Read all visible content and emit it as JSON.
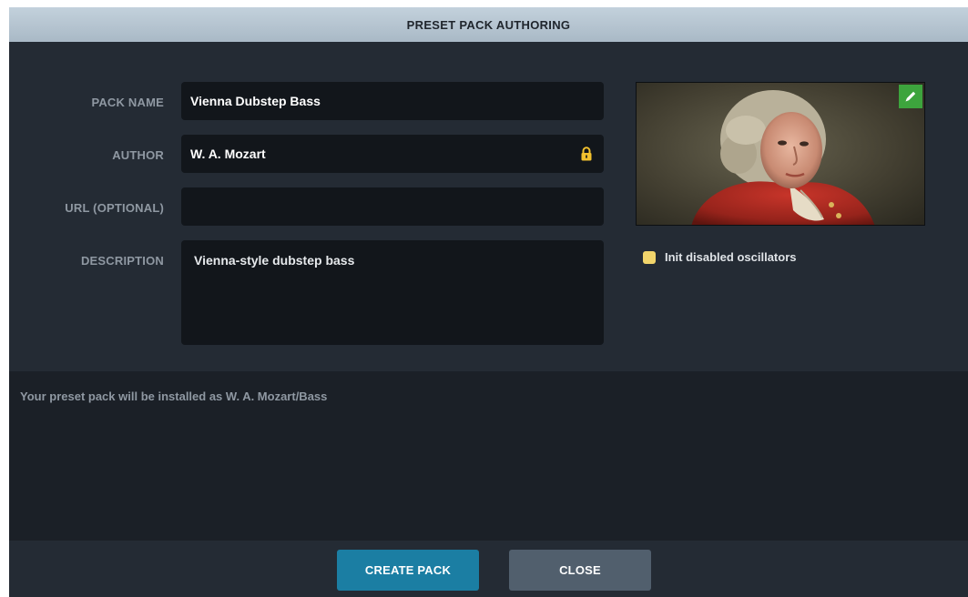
{
  "dialog": {
    "title": "PRESET PACK AUTHORING"
  },
  "form": {
    "pack_name": {
      "label": "PACK NAME",
      "value": "Vienna Dubstep Bass"
    },
    "author": {
      "label": "AUTHOR",
      "value": "W. A. Mozart",
      "locked": true
    },
    "url": {
      "label": "URL (OPTIONAL)",
      "value": ""
    },
    "description": {
      "label": "DESCRIPTION",
      "value": "Vienna-style dubstep bass"
    }
  },
  "cover_image": {
    "edit_icon": "pencil-icon",
    "edit_badge_color": "#3da43d"
  },
  "options": {
    "init_disabled_oscillators": {
      "label": "Init disabled oscillators",
      "checked": true,
      "color": "#f2d56b"
    }
  },
  "info": {
    "install_message": "Your preset pack will be installed as W. A. Mozart/Bass"
  },
  "buttons": {
    "create_label": "CREATE PACK",
    "close_label": "CLOSE"
  },
  "colors": {
    "accent": "#1b7ea3",
    "lock": "#f2c12e"
  }
}
